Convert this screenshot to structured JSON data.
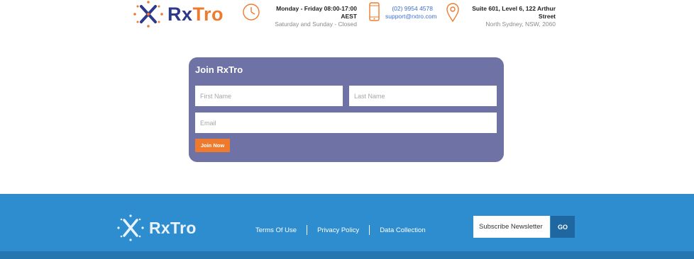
{
  "header": {
    "logo": {
      "rx": "Rx",
      "tro": "Tro"
    },
    "hours": {
      "line1": "Monday - Friday 08:00-17:00 AEST",
      "line2": "Saturday and Sunday - Closed"
    },
    "contact": {
      "phone": "(02) 9954 4578",
      "email": "support@rxtro.com"
    },
    "address": {
      "line1": "Suite 601, Level 6, 122 Arthur Street",
      "line2": "North Sydney, NSW, 2060"
    }
  },
  "join_form": {
    "title": "Join RxTro",
    "first_name_placeholder": "First Name",
    "last_name_placeholder": "Last Name",
    "email_placeholder": "Email",
    "submit_label": "Join Now"
  },
  "footer": {
    "logo_text": "RxTro",
    "links": [
      "Terms Of Use",
      "Privacy Policy",
      "Data Collection"
    ],
    "newsletter_placeholder": "Subscribe Newsletter",
    "go_label": "GO"
  },
  "colors": {
    "brand_blue": "#2d3a8c",
    "brand_orange": "#ef7a2e",
    "card_bg": "#6e72a4",
    "footer_bg": "#2e8dcf"
  }
}
